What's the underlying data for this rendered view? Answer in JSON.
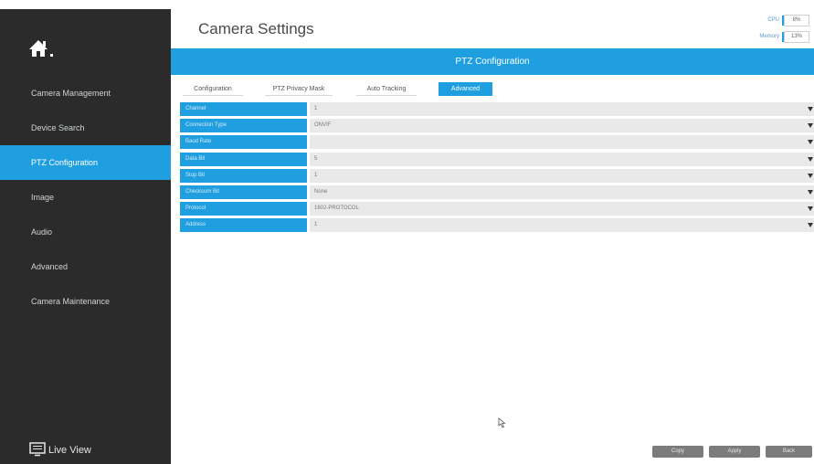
{
  "header": {
    "title": "Camera Settings"
  },
  "stats": {
    "cpu_label": "CPU",
    "cpu_value": "8%",
    "memory_label": "Memory",
    "memory_value": "13%"
  },
  "banner": {
    "title": "PTZ Configuration"
  },
  "tabs": [
    {
      "label": "Configuration",
      "active": false
    },
    {
      "label": "PTZ Privacy Mask",
      "active": false
    },
    {
      "label": "Auto Tracking",
      "active": false
    },
    {
      "label": "Advanced",
      "active": true
    }
  ],
  "sidebar": {
    "home_icon": "home-icon",
    "items": [
      {
        "label": "Camera Management",
        "active": false
      },
      {
        "label": "Device Search",
        "active": false
      },
      {
        "label": "PTZ Configuration",
        "active": true
      },
      {
        "label": "Image",
        "active": false
      },
      {
        "label": "Audio",
        "active": false
      },
      {
        "label": "Advanced",
        "active": false
      },
      {
        "label": "Camera Maintenance",
        "active": false
      }
    ],
    "live_view": {
      "label": "Live View",
      "icon": "monitor-icon"
    }
  },
  "form": [
    {
      "label": "Channel",
      "value": "1"
    },
    {
      "label": "Connection Type",
      "value": "ONVIF"
    },
    {
      "label": "Baud Rate",
      "value": ""
    },
    {
      "label": "Data Bit",
      "value": "5"
    },
    {
      "label": "Stop Bit",
      "value": "1"
    },
    {
      "label": "Checksum Bit",
      "value": "None"
    },
    {
      "label": "Protocol",
      "value": "1602-PROTOCOL"
    },
    {
      "label": "Address",
      "value": "1"
    }
  ],
  "buttons": {
    "copy": "Copy",
    "apply": "Apply",
    "back": "Back"
  },
  "colors": {
    "accent": "#1f9fe0",
    "sidebar": "#2b2b2b",
    "button": "#7b7b7b"
  }
}
